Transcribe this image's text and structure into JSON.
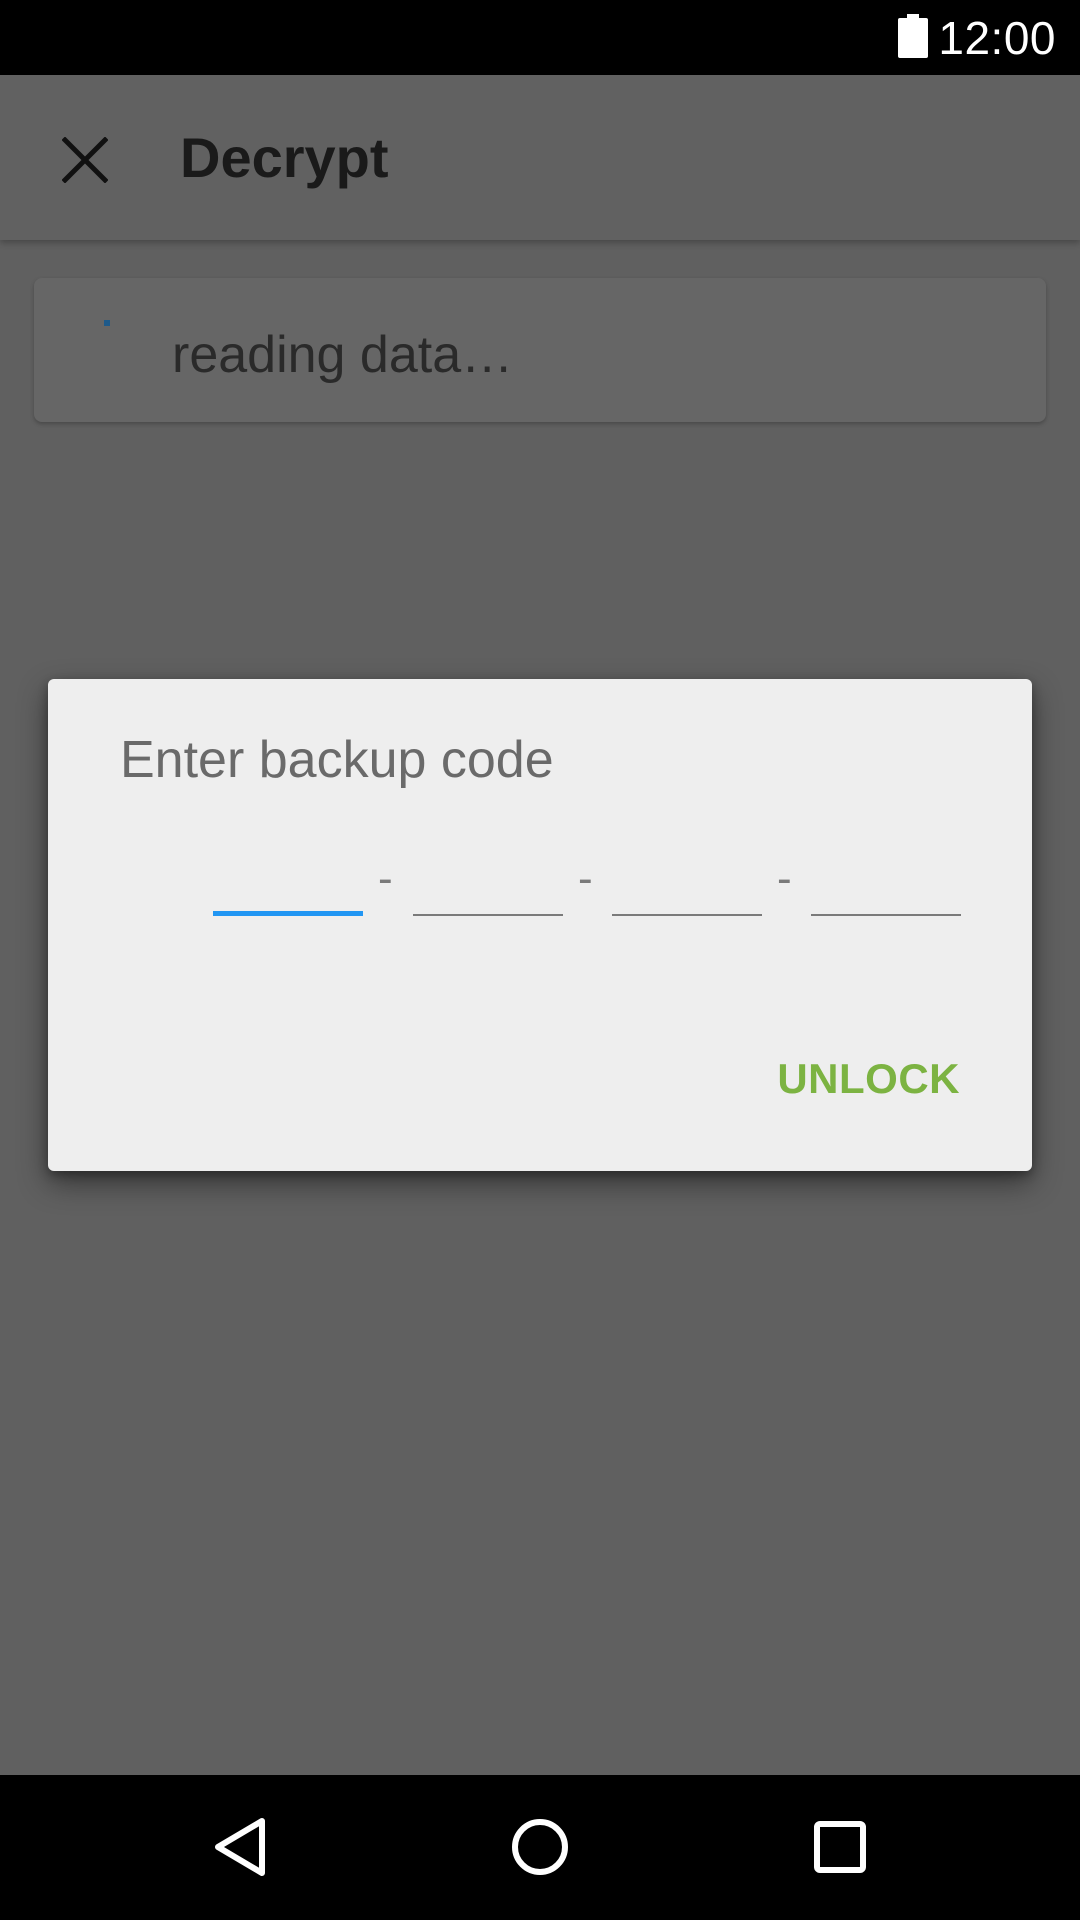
{
  "status_bar": {
    "time": "12:00",
    "battery_icon": "battery-full-icon"
  },
  "app_bar": {
    "close_icon": "close-icon",
    "title": "Decrypt"
  },
  "status_card": {
    "text": "reading data…"
  },
  "dialog": {
    "title": "Enter backup code",
    "separators": [
      "-",
      "-",
      "-"
    ],
    "fields": [
      {
        "value": "",
        "active": true
      },
      {
        "value": "",
        "active": false
      },
      {
        "value": "",
        "active": false
      },
      {
        "value": "",
        "active": false
      }
    ],
    "unlock_label": "UNLOCK"
  },
  "nav_bar": {
    "back_icon": "back-triangle-icon",
    "home_icon": "home-circle-icon",
    "recents_icon": "recents-square-icon"
  },
  "colors": {
    "accent_blue": "#2196f3",
    "unlock_green": "#7cb342",
    "scrim": "#606060",
    "dialog_bg": "#eeeeee"
  }
}
